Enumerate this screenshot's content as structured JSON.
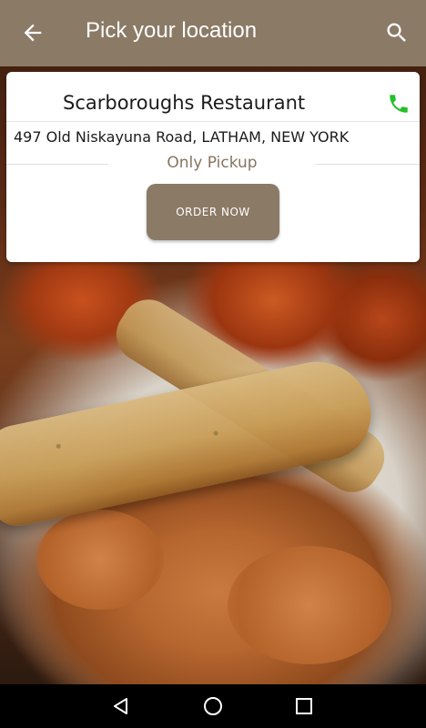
{
  "appbar": {
    "title": "Pick your location",
    "back_icon": "arrow-left-icon",
    "search_icon": "search-icon",
    "background_color": "#8b7a66"
  },
  "restaurant": {
    "name": "Scarboroughs Restaurant",
    "address": "497 Old Niskayuna Road, LATHAM, NEW YORK",
    "service_type": "Only Pickup",
    "order_button_label": "ORDER NOW",
    "phone_icon": "phone-icon",
    "phone_icon_color": "#22c02a",
    "accent_color": "#8b7a66"
  },
  "navbar": {
    "back_icon": "nav-back-icon",
    "home_icon": "nav-home-icon",
    "recent_icon": "nav-recent-icon"
  }
}
